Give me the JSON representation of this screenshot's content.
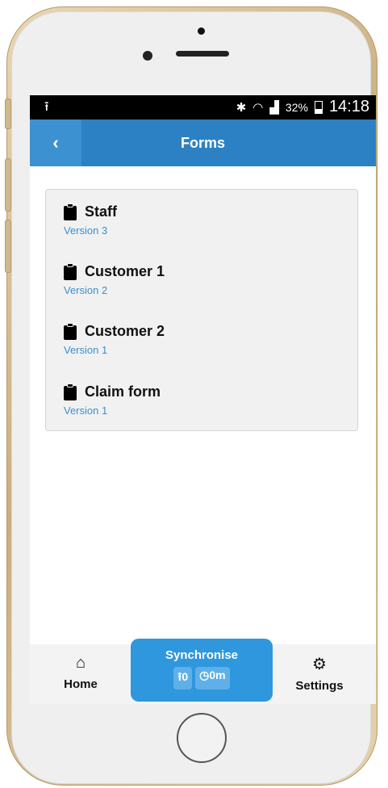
{
  "statusbar": {
    "left_icon": "upload-icon",
    "bluetooth_icon": "bluetooth-icon",
    "wifi_icon": "wifi-icon",
    "signal_icon": "signal-icon",
    "battery_percent": "32%",
    "time": "14:18"
  },
  "header": {
    "back_icon": "back-chevron-icon",
    "title": "Forms"
  },
  "forms": [
    {
      "name": "Staff",
      "version": "Version 3",
      "icon": "clipboard-icon"
    },
    {
      "name": "Customer 1",
      "version": "Version 2",
      "icon": "clipboard-icon"
    },
    {
      "name": "Customer 2",
      "version": "Version 1",
      "icon": "clipboard-icon"
    },
    {
      "name": "Claim form",
      "version": "Version 1",
      "icon": "clipboard-icon"
    }
  ],
  "bottom_nav": {
    "home": {
      "label": "Home",
      "icon": "home-icon"
    },
    "sync": {
      "label": "Synchronise",
      "uploads": "0",
      "elapsed": "0m"
    },
    "settings": {
      "label": "Settings",
      "icon": "gear-icon"
    }
  },
  "colors": {
    "primary": "#2c81c4",
    "back_button": "#3c91d1",
    "sync_button": "#2f97de",
    "version_text": "#3a8fd0"
  }
}
